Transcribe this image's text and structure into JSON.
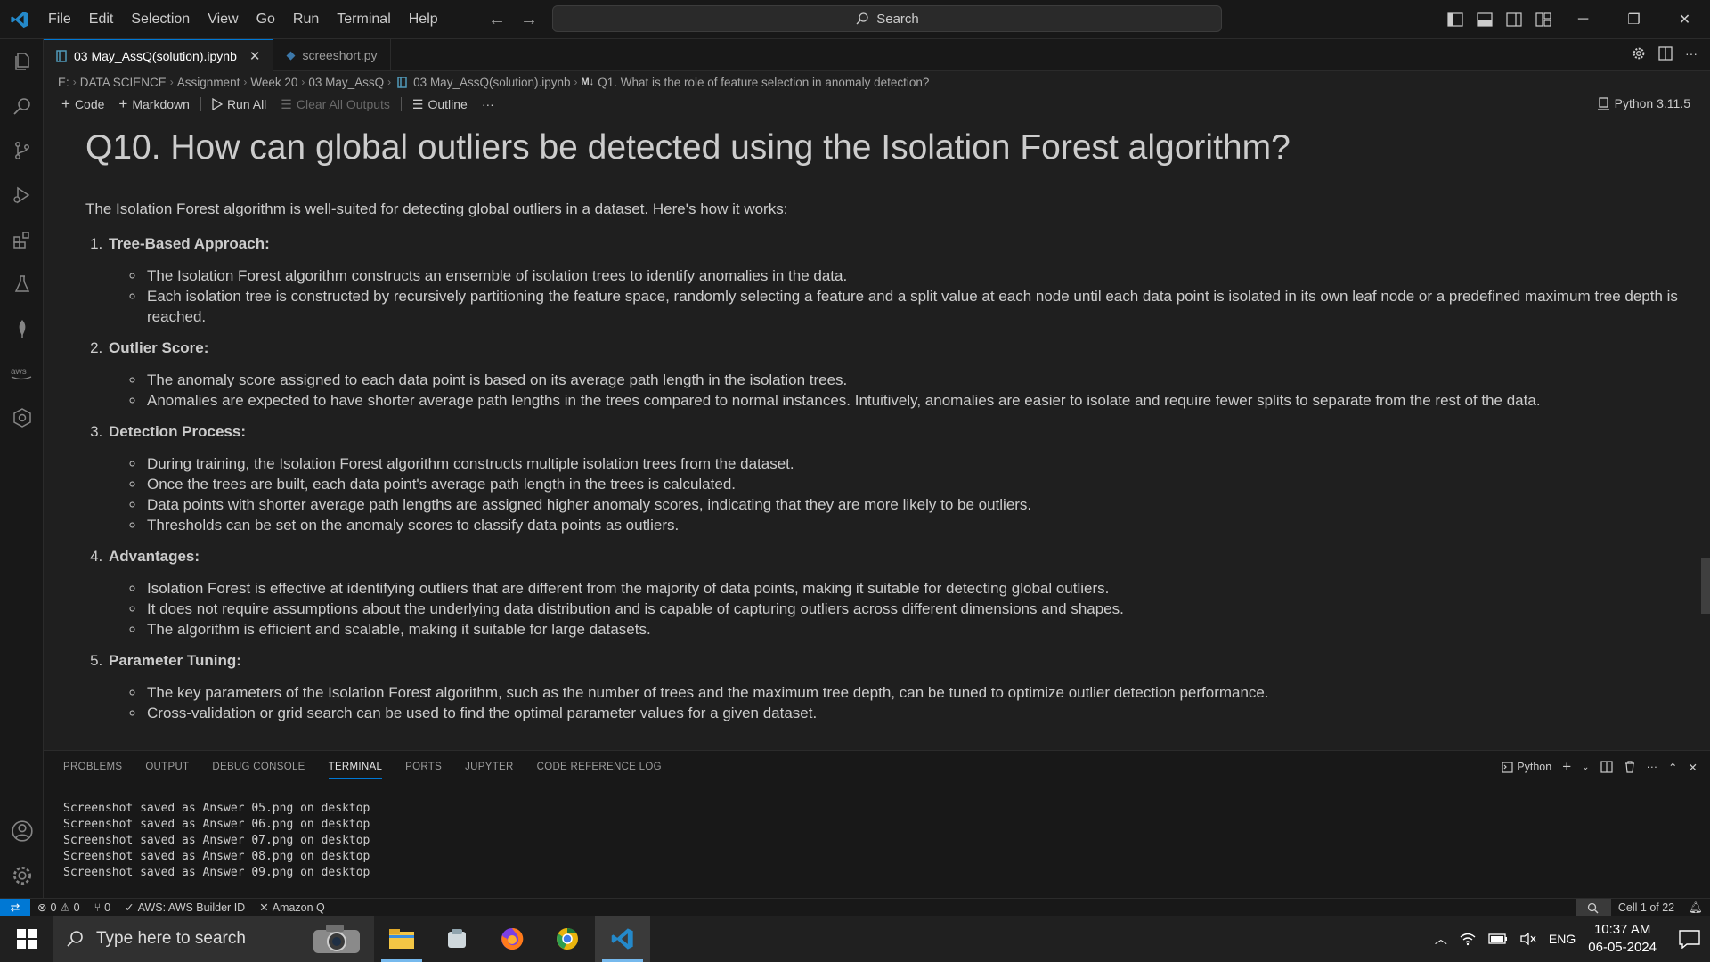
{
  "titlebar": {
    "menu": [
      "File",
      "Edit",
      "Selection",
      "View",
      "Go",
      "Run",
      "Terminal",
      "Help"
    ],
    "search_label": "Search"
  },
  "tabs": [
    {
      "label": "03 May_AssQ(solution).ipynb",
      "active": true
    },
    {
      "label": "screeshort.py",
      "active": false
    }
  ],
  "breadcrumb": [
    "E:",
    "DATA SCIENCE",
    "Assignment",
    "Week 20",
    "03 May_AssQ",
    "03 May_AssQ(solution).ipynb",
    "Q1. What is the role of feature selection in anomaly detection?"
  ],
  "notebook_toolbar": {
    "code": "Code",
    "markdown": "Markdown",
    "run_all": "Run All",
    "clear_outputs": "Clear All Outputs",
    "outline": "Outline",
    "more": "···",
    "kernel": "Python 3.11.5"
  },
  "cell": {
    "heading": "Q10. How can global outliers be detected using the Isolation Forest algorithm?",
    "intro": "The Isolation Forest algorithm is well-suited for detecting global outliers in a dataset. Here's how it works:",
    "sections": [
      {
        "title": "Tree-Based Approach:",
        "bullets": [
          "The Isolation Forest algorithm constructs an ensemble of isolation trees to identify anomalies in the data.",
          "Each isolation tree is constructed by recursively partitioning the feature space, randomly selecting a feature and a split value at each node until each data point is isolated in its own leaf node or a predefined maximum tree depth is reached."
        ]
      },
      {
        "title": "Outlier Score:",
        "bullets": [
          "The anomaly score assigned to each data point is based on its average path length in the isolation trees.",
          "Anomalies are expected to have shorter average path lengths in the trees compared to normal instances. Intuitively, anomalies are easier to isolate and require fewer splits to separate from the rest of the data."
        ]
      },
      {
        "title": "Detection Process:",
        "bullets": [
          "During training, the Isolation Forest algorithm constructs multiple isolation trees from the dataset.",
          "Once the trees are built, each data point's average path length in the trees is calculated.",
          "Data points with shorter average path lengths are assigned higher anomaly scores, indicating that they are more likely to be outliers.",
          "Thresholds can be set on the anomaly scores to classify data points as outliers."
        ]
      },
      {
        "title": "Advantages:",
        "bullets": [
          "Isolation Forest is effective at identifying outliers that are different from the majority of data points, making it suitable for detecting global outliers.",
          "It does not require assumptions about the underlying data distribution and is capable of capturing outliers across different dimensions and shapes.",
          "The algorithm is efficient and scalable, making it suitable for large datasets."
        ]
      },
      {
        "title": "Parameter Tuning:",
        "bullets": [
          "The key parameters of the Isolation Forest algorithm, such as the number of trees and the maximum tree depth, can be tuned to optimize outlier detection performance.",
          "Cross-validation or grid search can be used to find the optimal parameter values for a given dataset."
        ]
      }
    ]
  },
  "panel": {
    "tabs": [
      "PROBLEMS",
      "OUTPUT",
      "DEBUG CONSOLE",
      "TERMINAL",
      "PORTS",
      "JUPYTER",
      "CODE REFERENCE LOG"
    ],
    "active_tab": "TERMINAL",
    "terminal_profile": "Python",
    "terminal_lines": [
      "Screenshot saved as Answer 05.png on desktop",
      "Screenshot saved as Answer 06.png on desktop",
      "Screenshot saved as Answer 07.png on desktop",
      "Screenshot saved as Answer 08.png on desktop",
      "Screenshot saved as Answer 09.png on desktop"
    ]
  },
  "statusbar": {
    "errors": "0",
    "warnings": "0",
    "ports": "0",
    "aws": "AWS: AWS Builder ID",
    "amazon_q": "Amazon Q",
    "cell_position": "Cell 1 of 22"
  },
  "taskbar": {
    "search_placeholder": "Type here to search",
    "language": "ENG",
    "time": "10:37 AM",
    "date": "06-05-2024"
  },
  "colors": {
    "accent": "#0078d4",
    "editor_bg": "#1f1f1f",
    "chrome_bg": "#181818"
  }
}
